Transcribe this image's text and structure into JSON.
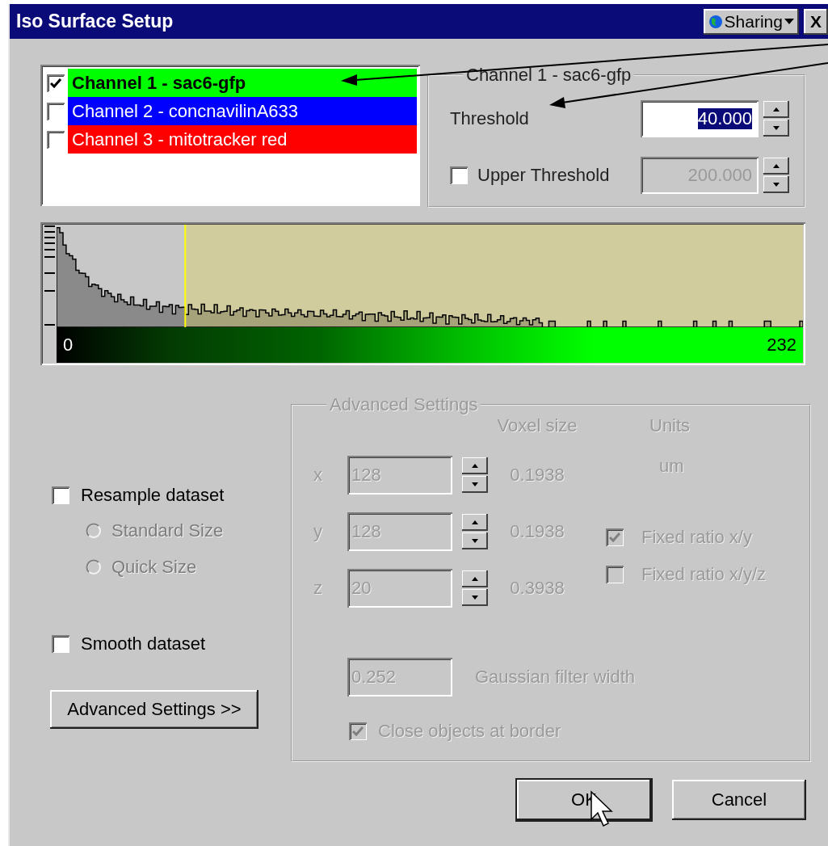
{
  "window": {
    "title": "Iso Surface Setup",
    "sharing_button": "Sharing",
    "close_button": "X"
  },
  "channels": [
    {
      "label": "Channel 1 - sac6-gfp",
      "checked": true,
      "selected": true,
      "color": "#00ff00"
    },
    {
      "label": "Channel 2 - concnavilinA633",
      "checked": false,
      "selected": false,
      "color": "#0000ff"
    },
    {
      "label": "Channel 3 - mitotracker red",
      "checked": false,
      "selected": false,
      "color": "#ff0000"
    }
  ],
  "channel_settings": {
    "title": "Channel 1 - sac6-gfp",
    "threshold": {
      "label": "Threshold",
      "value": "40.000",
      "highlighted": true
    },
    "upper_threshold": {
      "label": "Upper Threshold",
      "checked": false,
      "value": "200.000",
      "disabled": true
    }
  },
  "histogram": {
    "range_min": "0",
    "range_max": "232"
  },
  "resample": {
    "label": "Resample dataset",
    "checked": false
  },
  "size_options": [
    {
      "label": "Standard Size",
      "selected": false,
      "disabled": true
    },
    {
      "label": "Quick Size",
      "selected": false,
      "disabled": true
    }
  ],
  "smooth": {
    "label": "Smooth dataset",
    "checked": false
  },
  "advanced_button": "Advanced Settings >>",
  "advanced_settings": {
    "title": "Advanced Settings",
    "disabled": true,
    "voxel_header": "Voxel size",
    "units_header": "Units",
    "unit": "um",
    "axes": [
      {
        "axis": "x",
        "value": "128",
        "voxel_size": "0.1938"
      },
      {
        "axis": "y",
        "value": "128",
        "voxel_size": "0.1938"
      },
      {
        "axis": "z",
        "value": "20",
        "voxel_size": "0.3938"
      }
    ],
    "ratio_options": [
      {
        "label": "Fixed ratio x/y",
        "checked": true
      },
      {
        "label": "Fixed ratio x/y/z",
        "checked": false
      }
    ],
    "filter": {
      "value": "0.252",
      "label": "Gaussian filter width"
    },
    "close_objects": {
      "label": "Close objects at border",
      "checked": true
    }
  },
  "buttons": [
    {
      "label": "OK",
      "focused": true
    },
    {
      "label": "Cancel",
      "focused": false
    }
  ]
}
